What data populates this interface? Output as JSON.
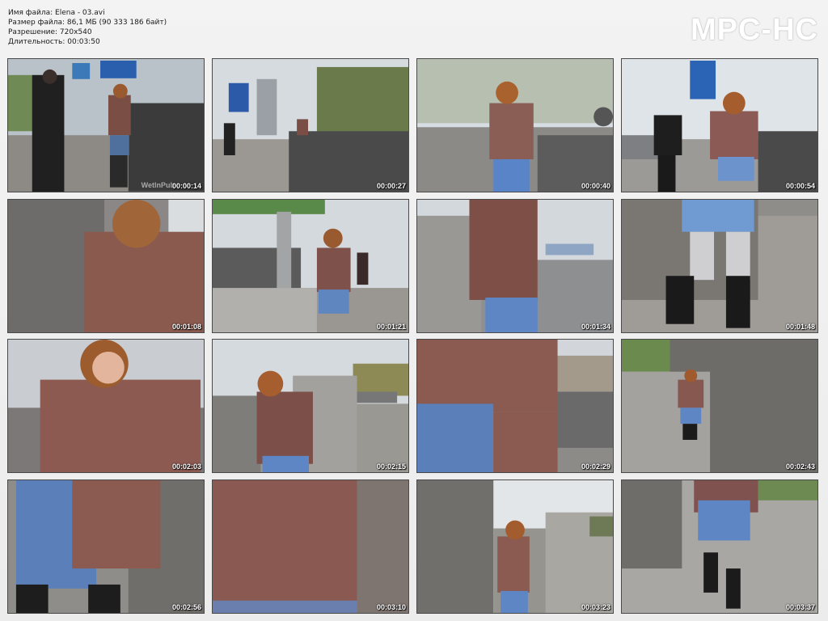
{
  "file_info": {
    "name_line": "Имя файла: Elena - 03.avi",
    "size_line": "Размер файла: 86,1 МБ (90 333 186 байт)",
    "resolution_line": "Разрешение: 720x540",
    "duration_line": "Длительность: 00:03:50"
  },
  "brand": "MPC-HC",
  "watermark": "WetlnPub",
  "thumbnails": [
    {
      "time": "00:00:14"
    },
    {
      "time": "00:00:27"
    },
    {
      "time": "00:00:40"
    },
    {
      "time": "00:00:54"
    },
    {
      "time": "00:01:08"
    },
    {
      "time": "00:01:21"
    },
    {
      "time": "00:01:34"
    },
    {
      "time": "00:01:48"
    },
    {
      "time": "00:02:03"
    },
    {
      "time": "00:02:15"
    },
    {
      "time": "00:02:29"
    },
    {
      "time": "00:02:43"
    },
    {
      "time": "00:02:56"
    },
    {
      "time": "00:03:10"
    },
    {
      "time": "00:03:23"
    },
    {
      "time": "00:03:37"
    }
  ]
}
